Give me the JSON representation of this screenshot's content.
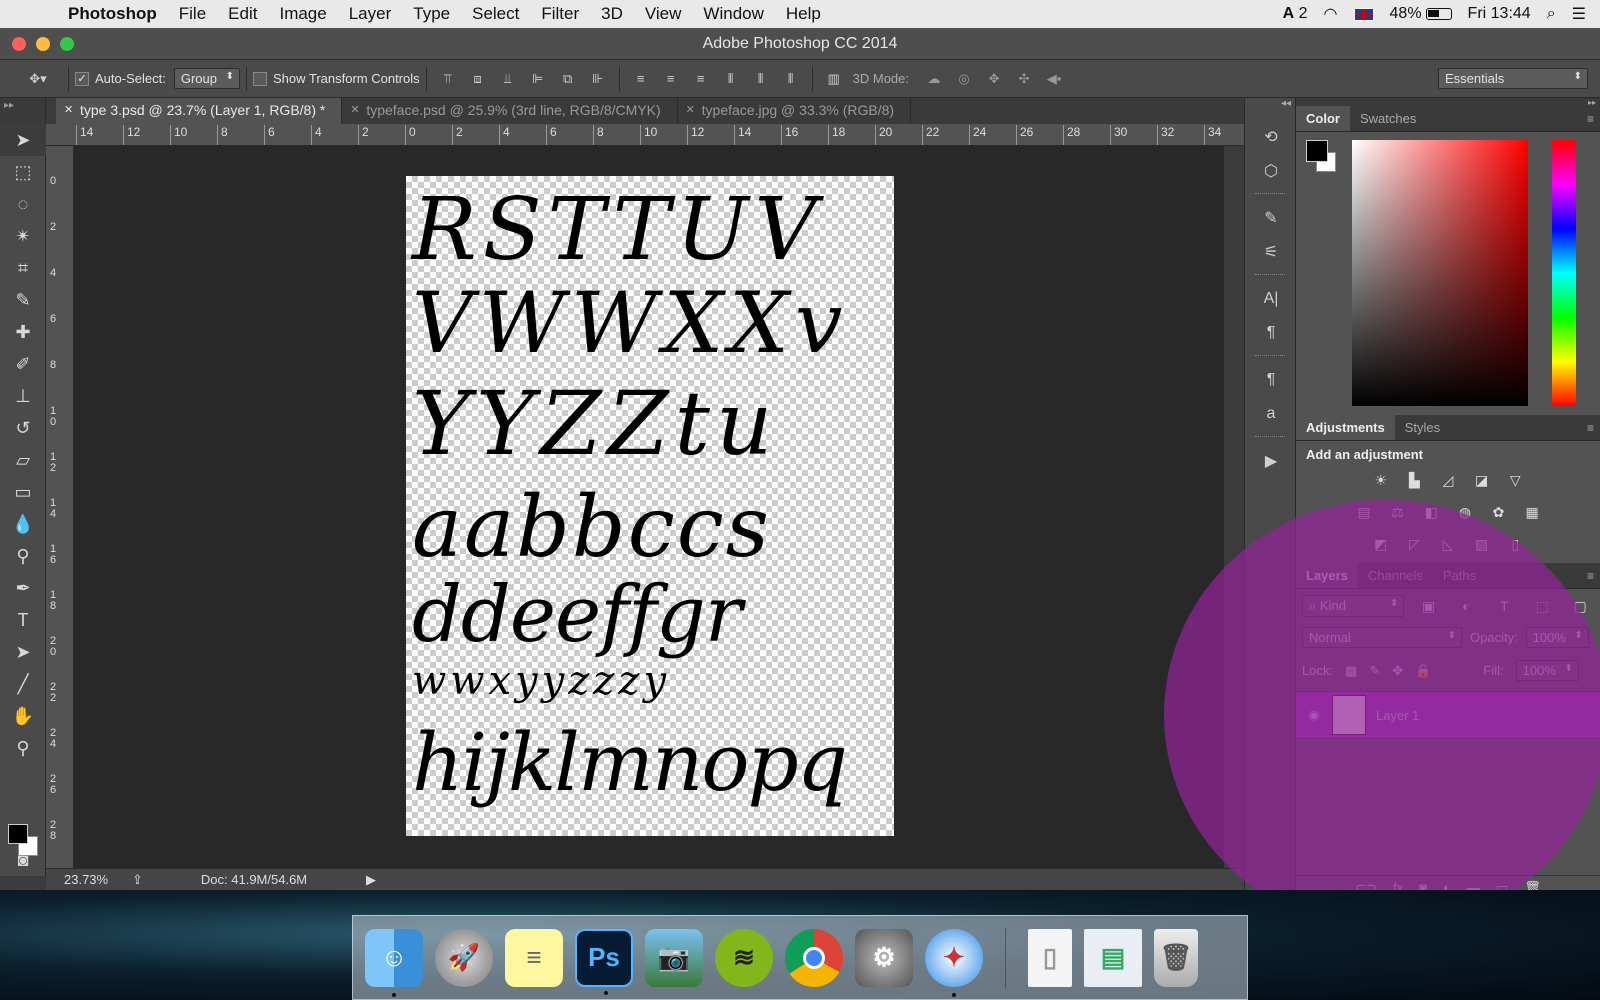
{
  "menubar": {
    "app": "Photoshop",
    "items": [
      "File",
      "Edit",
      "Image",
      "Layer",
      "Type",
      "Select",
      "Filter",
      "3D",
      "View",
      "Window",
      "Help"
    ],
    "adobe_count": "2",
    "battery": "48%",
    "clock": "Fri 13:44"
  },
  "window": {
    "title": "Adobe Photoshop CC 2014"
  },
  "options": {
    "auto_select_label": "Auto-Select:",
    "auto_select_value": "Group",
    "transform_label": "Show Transform Controls",
    "mode3d_label": "3D Mode:",
    "workspace": "Essentials"
  },
  "tabs": [
    {
      "label": "type 3.psd @ 23.7% (Layer 1, RGB/8) *"
    },
    {
      "label": "typeface.psd @ 25.9% (3rd line, RGB/8/CMYK)"
    },
    {
      "label": "typeface.jpg @ 33.3% (RGB/8)"
    }
  ],
  "ruler_top": [
    "14",
    "12",
    "10",
    "8",
    "6",
    "4",
    "2",
    "0",
    "2",
    "4",
    "6",
    "8",
    "10",
    "12",
    "14",
    "16",
    "18",
    "20",
    "22",
    "24",
    "26",
    "28",
    "30",
    "32",
    "34"
  ],
  "ruler_left": [
    "0",
    "2",
    "4",
    "6",
    "8",
    "1 0",
    "1 2",
    "1 4",
    "1 6",
    "1 8",
    "2 0",
    "2 2",
    "2 4",
    "2 6",
    "2 8"
  ],
  "canvas_lines": [
    "RSTTUV",
    "VWWXXv",
    "YYZZtu",
    "aabbccs",
    "ddeeffgr",
    "wwxyyzzzy",
    "hijklmnopq"
  ],
  "status": {
    "zoom": "23.73%",
    "doc": "Doc: 41.9M/54.6M"
  },
  "color_panel": {
    "tabs": [
      "Color",
      "Swatches"
    ]
  },
  "adjustments_panel": {
    "tabs": [
      "Adjustments",
      "Styles"
    ],
    "heading": "Add an adjustment"
  },
  "layers_panel": {
    "tabs": [
      "Layers",
      "Channels",
      "Paths"
    ],
    "filter": "Kind",
    "blend_mode": "Normal",
    "opacity_label": "Opacity:",
    "opacity": "100%",
    "lock_label": "Lock:",
    "fill_label": "Fill:",
    "fill": "100%",
    "layers": [
      {
        "name": "Layer 1"
      }
    ]
  },
  "colors": {
    "accent_purple": "#922398",
    "layer_selected": "#9b3fb3",
    "panel_bg": "#535353"
  }
}
